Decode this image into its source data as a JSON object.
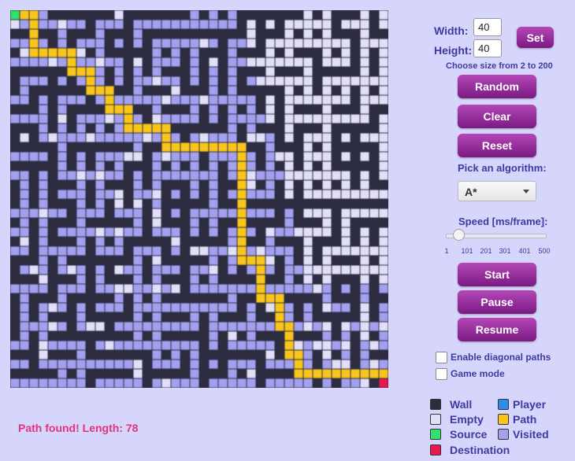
{
  "grid": {
    "cols": 40,
    "rows": 40,
    "colors": {
      "wall": "#2d2c40",
      "empty": "#e1dffa",
      "visited": "#a2a0ef",
      "path": "#f9c51b",
      "source": "#2fe26a",
      "destination": "#e8174f",
      "player": "#2d8cee"
    }
  },
  "status": {
    "message": "Path found! Length: 78"
  },
  "size": {
    "width_label": "Width:",
    "height_label": "Height:",
    "width_value": "40",
    "height_value": "40",
    "set_label": "Set",
    "hint": "Choose size from 2 to 200"
  },
  "buttons": {
    "random": "Random",
    "clear": "Clear",
    "reset": "Reset",
    "start": "Start",
    "pause": "Pause",
    "resume": "Resume"
  },
  "algorithm": {
    "label": "Pick an algorithm:",
    "selected": "A*"
  },
  "speed": {
    "label": "Speed [ms/frame]:",
    "value": 50,
    "min": 1,
    "max": 500,
    "ticks": [
      "1",
      "101",
      "201",
      "301",
      "401",
      "500"
    ]
  },
  "options": {
    "diagonal": "Enable diagonal paths",
    "game_mode": "Game mode"
  },
  "legend": {
    "wall": "Wall",
    "empty": "Empty",
    "source": "Source",
    "destination": "Destination",
    "player": "Player",
    "path": "Path",
    "visited": "Visited"
  }
}
